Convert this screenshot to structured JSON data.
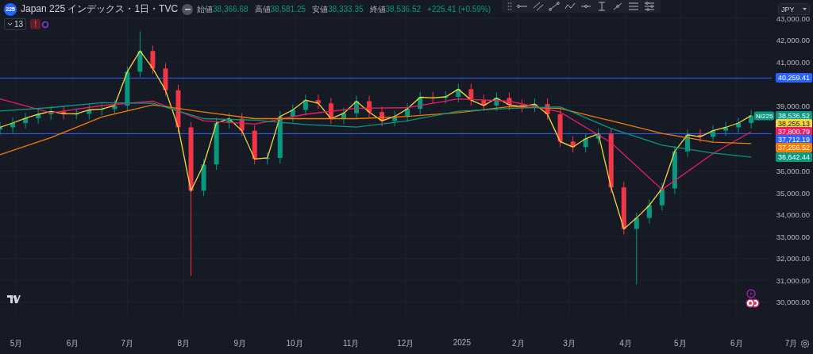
{
  "legend": {
    "symbol_badge": "225",
    "title": "Japan 225 インデックス・1日・TVC",
    "ohlc": [
      {
        "label": "始値",
        "value": "38,366.68"
      },
      {
        "label": "高値",
        "value": "38,581.25"
      },
      {
        "label": "安値",
        "value": "38,333.35"
      },
      {
        "label": "終値",
        "value": "38,536.52"
      }
    ],
    "change": "+225.41 (+0.59%)",
    "indicators_count": "13",
    "alert_badge": "!"
  },
  "currency": "JPY",
  "price_markers": [
    {
      "label": "38,536.52",
      "tag": "NI225",
      "color": "#089981"
    },
    {
      "label": "38,255.13",
      "color": "#f5d63d"
    },
    {
      "label": "37,800.79",
      "color": "#e91e63"
    },
    {
      "label": "37,256.52",
      "color": "#f57c00"
    },
    {
      "label": "36,642.44",
      "color": "#089981"
    }
  ],
  "chart_data": {
    "type": "candlestick",
    "grid": true,
    "x": [
      "2024-04-22",
      "2024-04-29",
      "2024-05-06",
      "2024-05-13",
      "2024-05-20",
      "2024-05-27",
      "2024-06-03",
      "2024-06-10",
      "2024-06-17",
      "2024-06-24",
      "2024-07-01",
      "2024-07-08",
      "2024-07-15",
      "2024-07-22",
      "2024-07-29",
      "2024-08-05",
      "2024-08-12",
      "2024-08-19",
      "2024-08-26",
      "2024-09-02",
      "2024-09-09",
      "2024-09-16",
      "2024-09-23",
      "2024-09-30",
      "2024-10-07",
      "2024-10-14",
      "2024-10-21",
      "2024-10-28",
      "2024-11-04",
      "2024-11-11",
      "2024-11-18",
      "2024-11-25",
      "2024-12-02",
      "2024-12-09",
      "2024-12-16",
      "2024-12-23",
      "2024-12-30",
      "2025-01-06",
      "2025-01-13",
      "2025-01-20",
      "2025-01-27",
      "2025-02-03",
      "2025-02-10",
      "2025-02-17",
      "2025-02-24",
      "2025-03-03",
      "2025-03-10",
      "2025-03-17",
      "2025-03-24",
      "2025-03-31",
      "2025-04-07",
      "2025-04-14",
      "2025-04-21",
      "2025-04-28",
      "2025-05-05",
      "2025-05-12",
      "2025-05-19",
      "2025-05-26",
      "2025-06-02",
      "2025-06-09"
    ],
    "xlim": [
      "2024-04-22",
      "2025-07-13"
    ],
    "ylim": [
      27618,
      43836
    ],
    "xticks": [
      {
        "value": "2024-05-01",
        "label": "5月"
      },
      {
        "value": "2024-06-01",
        "label": "6月"
      },
      {
        "value": "2024-07-01",
        "label": "7月"
      },
      {
        "value": "2024-08-01",
        "label": "8月"
      },
      {
        "value": "2024-09-01",
        "label": "9月"
      },
      {
        "value": "2024-10-01",
        "label": "10月"
      },
      {
        "value": "2024-11-01",
        "label": "11月"
      },
      {
        "value": "2024-12-01",
        "label": "12月"
      },
      {
        "value": "2025-01-01",
        "label": "2025"
      },
      {
        "value": "2025-02-01",
        "label": "2月"
      },
      {
        "value": "2025-03-01",
        "label": "3月"
      },
      {
        "value": "2025-04-01",
        "label": "4月"
      },
      {
        "value": "2025-05-01",
        "label": "5月"
      },
      {
        "value": "2025-06-01",
        "label": "6月"
      },
      {
        "value": "2025-07-01",
        "label": "7月"
      }
    ],
    "yticks": [
      {
        "value": 43000,
        "label": "43,000.00"
      },
      {
        "value": 42000,
        "label": "42,000.00"
      },
      {
        "value": 41000,
        "label": "41,000.00"
      },
      {
        "value": 39000,
        "label": "39,000.00"
      },
      {
        "value": 36000,
        "label": "36,000.00"
      },
      {
        "value": 35000,
        "label": "35,000.00"
      },
      {
        "value": 34000,
        "label": "34,000.00"
      },
      {
        "value": 33000,
        "label": "33,000.00"
      },
      {
        "value": 32000,
        "label": "32,000.00"
      },
      {
        "value": 31000,
        "label": "31,000.00"
      },
      {
        "value": 30000,
        "label": "30,000.00"
      }
    ],
    "ohlc": [
      [
        37900,
        38250,
        37650,
        38000
      ],
      [
        38000,
        38450,
        37750,
        38200
      ],
      [
        38200,
        38670,
        37950,
        38420
      ],
      [
        38420,
        38850,
        38170,
        38600
      ],
      [
        38600,
        38980,
        38350,
        38730
      ],
      [
        38730,
        38980,
        38370,
        38620
      ],
      [
        38620,
        38870,
        38370,
        38620
      ],
      [
        38620,
        39050,
        38370,
        38800
      ],
      [
        38800,
        39090,
        38550,
        38840
      ],
      [
        38840,
        39250,
        38590,
        39000
      ],
      [
        39000,
        40800,
        38750,
        40550
      ],
      [
        40550,
        42400,
        40300,
        41500
      ],
      [
        41500,
        41750,
        40450,
        40700
      ],
      [
        40700,
        40950,
        39450,
        39700
      ],
      [
        39700,
        39950,
        37750,
        38000
      ],
      [
        38000,
        38250,
        31200,
        35100
      ],
      [
        35100,
        36550,
        34850,
        36300
      ],
      [
        36300,
        38450,
        36050,
        38200
      ],
      [
        38200,
        38650,
        37950,
        38400
      ],
      [
        38400,
        38650,
        37600,
        37850
      ],
      [
        37850,
        38100,
        36300,
        36550
      ],
      [
        36550,
        36850,
        36300,
        36600
      ],
      [
        36600,
        38750,
        36350,
        38500
      ],
      [
        38500,
        39050,
        38250,
        38800
      ],
      [
        38800,
        39500,
        38550,
        39250
      ],
      [
        39250,
        39500,
        38850,
        39100
      ],
      [
        39100,
        39350,
        38150,
        38400
      ],
      [
        38400,
        38900,
        38150,
        38650
      ],
      [
        38650,
        39450,
        38400,
        39200
      ],
      [
        39200,
        39450,
        38450,
        38700
      ],
      [
        38700,
        38950,
        38050,
        38300
      ],
      [
        38300,
        38750,
        38050,
        38500
      ],
      [
        38500,
        39100,
        38250,
        38850
      ],
      [
        38850,
        39630,
        38600,
        39380
      ],
      [
        39380,
        39630,
        39100,
        39350
      ],
      [
        39350,
        39650,
        39100,
        39400
      ],
      [
        39400,
        40000,
        39150,
        39750
      ],
      [
        39750,
        40000,
        39000,
        39250
      ],
      [
        39250,
        39500,
        38750,
        39000
      ],
      [
        39000,
        39600,
        38750,
        39350
      ],
      [
        39350,
        39600,
        38780,
        39030
      ],
      [
        39030,
        39280,
        38700,
        38950
      ],
      [
        38950,
        39320,
        38700,
        39070
      ],
      [
        39070,
        39320,
        38350,
        38600
      ],
      [
        38600,
        38850,
        37100,
        37350
      ],
      [
        37350,
        37600,
        36850,
        37100
      ],
      [
        37100,
        37730,
        36850,
        37480
      ],
      [
        37480,
        37950,
        37230,
        37700
      ],
      [
        37700,
        37950,
        35000,
        35250
      ],
      [
        35250,
        35500,
        33100,
        33350
      ],
      [
        33350,
        34100,
        30800,
        33850
      ],
      [
        33850,
        34680,
        33600,
        34430
      ],
      [
        34430,
        35450,
        34180,
        35200
      ],
      [
        35200,
        37150,
        34950,
        36900
      ],
      [
        36900,
        37910,
        36650,
        37660
      ],
      [
        37660,
        37910,
        37320,
        37570
      ],
      [
        37570,
        38100,
        37320,
        37850
      ],
      [
        37850,
        38250,
        37600,
        38000
      ],
      [
        38000,
        38450,
        37750,
        38200
      ],
      [
        38200,
        38790,
        37950,
        38540
      ]
    ],
    "series": [
      {
        "type": "line",
        "color": "#f5d63d",
        "values": [
          38000,
          38200,
          38420,
          38600,
          38730,
          38620,
          38620,
          38800,
          38840,
          39000,
          40550,
          41500,
          40700,
          39700,
          38000,
          35100,
          36300,
          38200,
          38400,
          37850,
          36550,
          36600,
          38500,
          38800,
          39250,
          39100,
          38400,
          38650,
          39200,
          38700,
          38300,
          38500,
          38850,
          39380,
          39350,
          39400,
          39750,
          39250,
          39000,
          39350,
          39030,
          38950,
          39070,
          38600,
          37350,
          37100,
          37480,
          37700,
          35250,
          33350,
          33850,
          34430,
          35200,
          36900,
          37660,
          37570,
          37850,
          38000,
          38200,
          38540
        ]
      },
      {
        "type": "line",
        "color": "#e91e63",
        "values": [
          39300,
          null,
          null,
          null,
          38670,
          null,
          null,
          null,
          39000,
          null,
          null,
          null,
          39200,
          null,
          null,
          null,
          38300,
          null,
          null,
          null,
          38150,
          null,
          null,
          null,
          38600,
          null,
          null,
          null,
          38880,
          null,
          null,
          null,
          38900,
          null,
          null,
          null,
          39300,
          null,
          null,
          null,
          39200,
          null,
          null,
          null,
          38700,
          null,
          null,
          null,
          37300,
          null,
          null,
          null,
          35150,
          null,
          null,
          null,
          36800,
          null,
          null,
          37800
        ]
      },
      {
        "type": "line",
        "color": "#f57c00",
        "values": [
          36750,
          null,
          null,
          null,
          37530,
          null,
          null,
          null,
          38480,
          null,
          null,
          null,
          39030,
          null,
          null,
          null,
          38700,
          null,
          null,
          null,
          38400,
          null,
          null,
          null,
          38400,
          null,
          null,
          null,
          38400,
          null,
          null,
          null,
          38500,
          null,
          null,
          null,
          38680,
          null,
          null,
          null,
          38950,
          null,
          null,
          null,
          38870,
          null,
          null,
          null,
          38300,
          null,
          null,
          null,
          37720,
          null,
          null,
          null,
          37320,
          null,
          null,
          37260
        ]
      },
      {
        "type": "line",
        "color": "#089981",
        "values": [
          38750,
          null,
          null,
          null,
          38910,
          null,
          null,
          null,
          39130,
          null,
          null,
          null,
          39100,
          null,
          null,
          null,
          38400,
          null,
          null,
          null,
          38330,
          null,
          null,
          null,
          38130,
          null,
          null,
          null,
          38010,
          null,
          null,
          null,
          38300,
          null,
          null,
          null,
          38740,
          null,
          null,
          null,
          38870,
          null,
          null,
          null,
          38940,
          null,
          null,
          null,
          37950,
          null,
          null,
          null,
          37190,
          null,
          null,
          null,
          36820,
          null,
          null,
          36640
        ]
      }
    ],
    "ref_lines": [
      {
        "axis": "y",
        "value": 40259.41,
        "label": "40,259.41",
        "color": "#2962ff"
      },
      {
        "axis": "y",
        "value": 37712.19,
        "label": "37,712.19",
        "color": "#2962ff"
      }
    ]
  }
}
